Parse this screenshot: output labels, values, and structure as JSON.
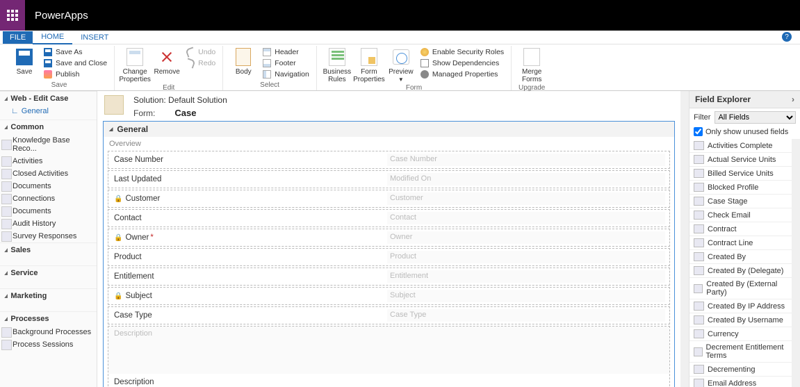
{
  "brand": "PowerApps",
  "tabs": {
    "file": "FILE",
    "home": "HOME",
    "insert": "INSERT"
  },
  "ribbon": {
    "save": {
      "big": "Save",
      "saveAs": "Save As",
      "saveClose": "Save and Close",
      "publish": "Publish",
      "group": "Save"
    },
    "edit": {
      "changeProps": "Change\nProperties",
      "remove": "Remove",
      "undo": "Undo",
      "redo": "Redo",
      "group": "Edit"
    },
    "select": {
      "body": "Body",
      "header": "Header",
      "footer": "Footer",
      "nav": "Navigation",
      "group": "Select"
    },
    "form": {
      "br": "Business\nRules",
      "fp": "Form\nProperties",
      "preview": "Preview",
      "sec": "Enable Security Roles",
      "deps": "Show Dependencies",
      "managed": "Managed Properties",
      "group": "Form"
    },
    "upgrade": {
      "merge": "Merge\nForms",
      "group": "Upgrade"
    }
  },
  "left": {
    "web": "Web - Edit Case",
    "general": "General",
    "common": "Common",
    "commonItems": [
      "Knowledge Base Reco...",
      "Activities",
      "Closed Activities",
      "Documents",
      "Connections",
      "Documents",
      "Audit History",
      "Survey Responses"
    ],
    "sales": "Sales",
    "service": "Service",
    "marketing": "Marketing",
    "processes": "Processes",
    "processItems": [
      "Background Processes",
      "Process Sessions"
    ]
  },
  "formHeader": {
    "solutionLabel": "Solution:",
    "solutionName": "Default Solution",
    "formLabel": "Form:",
    "entity": "Case"
  },
  "section": {
    "general": "General",
    "overview": "Overview"
  },
  "fields": [
    {
      "label": "Case Number",
      "ph": "Case Number",
      "locked": false,
      "required": false
    },
    {
      "label": "Last Updated",
      "ph": "Modified On",
      "locked": false,
      "required": false
    },
    {
      "label": "Customer",
      "ph": "Customer",
      "locked": true,
      "required": false
    },
    {
      "label": "Contact",
      "ph": "Contact",
      "locked": false,
      "required": false
    },
    {
      "label": "Owner",
      "ph": "Owner",
      "locked": true,
      "required": true
    },
    {
      "label": "Product",
      "ph": "Product",
      "locked": false,
      "required": false
    },
    {
      "label": "Entitlement",
      "ph": "Entitlement",
      "locked": false,
      "required": false
    },
    {
      "label": "Subject",
      "ph": "Subject",
      "locked": true,
      "required": false
    },
    {
      "label": "Case Type",
      "ph": "Case Type",
      "locked": false,
      "required": false
    }
  ],
  "desc": {
    "label": "Description",
    "ph": "Description"
  },
  "explorer": {
    "title": "Field Explorer",
    "filterLabel": "Filter",
    "filterValue": "All Fields",
    "unused": "Only show unused fields",
    "items": [
      "Activities Complete",
      "Actual Service Units",
      "Billed Service Units",
      "Blocked Profile",
      "Case Stage",
      "Check Email",
      "Contract",
      "Contract Line",
      "Created By",
      "Created By (Delegate)",
      "Created By (External Party)",
      "Created By IP Address",
      "Created By Username",
      "Currency",
      "Decrement Entitlement Terms",
      "Decrementing",
      "Email Address"
    ]
  }
}
